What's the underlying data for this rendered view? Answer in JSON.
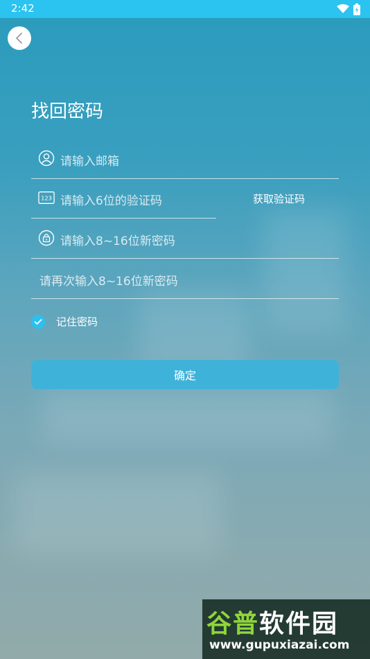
{
  "status_bar": {
    "time": "2:42"
  },
  "header": {
    "back_icon": "chevron-left-icon"
  },
  "page": {
    "title": "找回密码"
  },
  "form": {
    "email_placeholder": "请输入邮箱",
    "code_placeholder": "请输入6位的验证码",
    "get_code_label": "获取验证码",
    "new_password_placeholder": "请输入8~16位新密码",
    "confirm_password_placeholder": "请再次输入8~16位新密码",
    "remember_label": "记住密码",
    "remember_checked": true,
    "submit_label": "确定"
  },
  "icons": {
    "email": "user-icon",
    "code": "number-123-icon",
    "password": "lock-icon",
    "check": "checkmark-icon"
  },
  "colors": {
    "status_bar": "#2bc3f0",
    "button": "#3fb2da",
    "checkbox": "#2bc0ef",
    "watermark_accent": "#8fd63a"
  },
  "watermark": {
    "brand_part1": "谷普",
    "brand_part2": "软件园",
    "url": "www.gupuxiazai.com"
  }
}
